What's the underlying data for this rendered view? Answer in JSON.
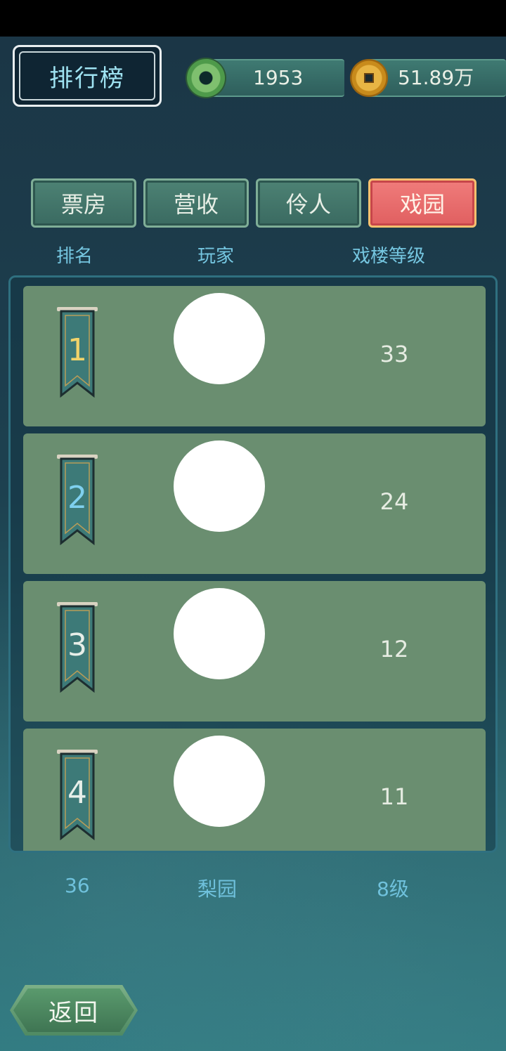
{
  "header": {
    "title": "排行榜",
    "currency_jade": "1953",
    "currency_coin": "51.89万",
    "icons": [
      "jade-disc-icon",
      "copper-coin-icon"
    ]
  },
  "tabs": [
    {
      "label": "票房",
      "active": false
    },
    {
      "label": "营收",
      "active": false
    },
    {
      "label": "伶人",
      "active": false
    },
    {
      "label": "戏园",
      "active": true
    }
  ],
  "columns": {
    "rank": "排名",
    "player": "玩家",
    "level": "戏楼等级"
  },
  "rows": [
    {
      "rank": "1",
      "level": "33",
      "rank_color": "#f1d36a"
    },
    {
      "rank": "2",
      "level": "24",
      "rank_color": "#7fd0ef"
    },
    {
      "rank": "3",
      "level": "12",
      "rank_color": "#e7eee8"
    },
    {
      "rank": "4",
      "level": "11",
      "rank_color": "#e7eee8"
    }
  ],
  "mine": {
    "rank": "36",
    "name": "梨园",
    "level": "8级"
  },
  "back_label": "返回",
  "colors": {
    "accent_text": "#75c6e0",
    "row_bg": "#6a8e70",
    "active_tab": "#e86a6b"
  }
}
